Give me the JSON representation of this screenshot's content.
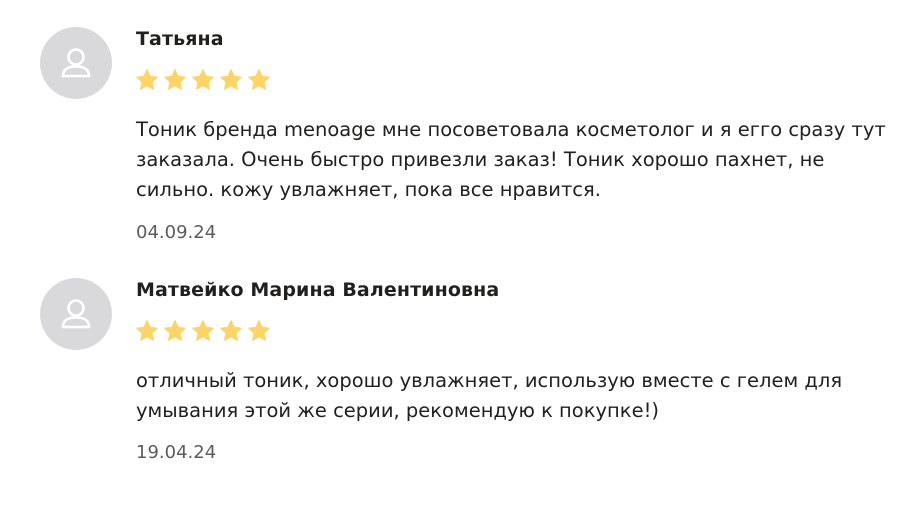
{
  "reviews": [
    {
      "author": "Татьяна",
      "rating": 5,
      "text": "Тоник бренда menoage мне посоветовала косметолог и я егго сразу тут заказала. Очень быстро привезли заказ! Тоник хорошо пахнет, не сильно. кожу увлажняет, пока все нравится.",
      "date": "04.09.24"
    },
    {
      "author": "Матвейко Марина Валентиновна",
      "rating": 5,
      "text": "отличный тоник, хорошо увлажняет, использую вместе с гелем для умывания этой же серии, рекомендую к покупке!)",
      "date": "19.04.24"
    }
  ],
  "colors": {
    "star": "#fcd468",
    "avatar_bg": "#d9d9dc",
    "avatar_icon": "#ffffff",
    "text": "#21201f",
    "date": "#5c5c5c"
  },
  "icons": {
    "avatar": "user-icon",
    "rating": "star-icon"
  }
}
